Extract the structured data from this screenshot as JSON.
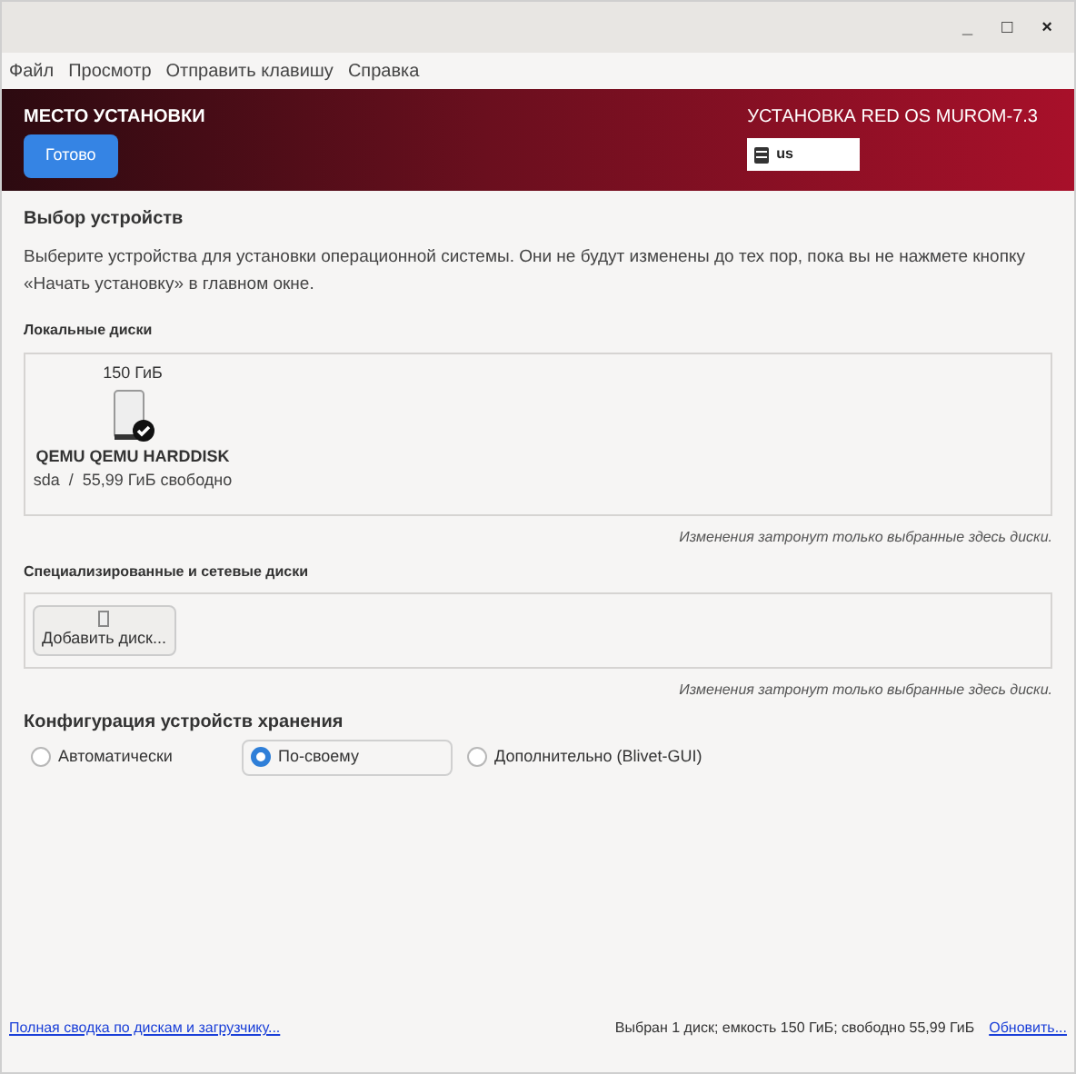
{
  "window": {
    "controls": [
      "_",
      "□",
      "×"
    ]
  },
  "menu": [
    "Файл",
    "Просмотр",
    "Отправить клавишу",
    "Справка"
  ],
  "header": {
    "title": "МЕСТО УСТАНОВКИ",
    "done_button": "Готово",
    "product": "УСТАНОВКА RED OS MUROM-7.3",
    "keyboard": "us"
  },
  "device_selection": {
    "heading": "Выбор устройств",
    "description": "Выберите устройства для установки операционной системы. Они не будут изменены до тех пор, пока вы не нажмете кнопку «Начать установку» в главном окне."
  },
  "local_disks": {
    "heading": "Локальные диски",
    "disks": [
      {
        "size": "150 ГиБ",
        "name": "QEMU QEMU HARDDISK",
        "info": "sda  /  55,99 ГиБ свободно",
        "selected": true
      }
    ],
    "note": "Изменения затронут только выбранные здесь диски."
  },
  "network_disks": {
    "heading": "Специализированные и сетевые диски",
    "add_button": "Добавить диск...",
    "note": "Изменения затронут только выбранные здесь диски."
  },
  "storage_config": {
    "heading": "Конфигурация устройств хранения",
    "options": [
      {
        "label": "Автоматически",
        "selected": false
      },
      {
        "label": "По-своему",
        "selected": true
      },
      {
        "label": "Дополнительно (Blivet-GUI)",
        "selected": false
      }
    ]
  },
  "footer": {
    "summary_link": "Полная сводка по дискам и загрузчику...",
    "status": "Выбран 1 диск; емкость 150 ГиБ; свободно 55,99 ГиБ",
    "refresh_link": "Обновить..."
  }
}
